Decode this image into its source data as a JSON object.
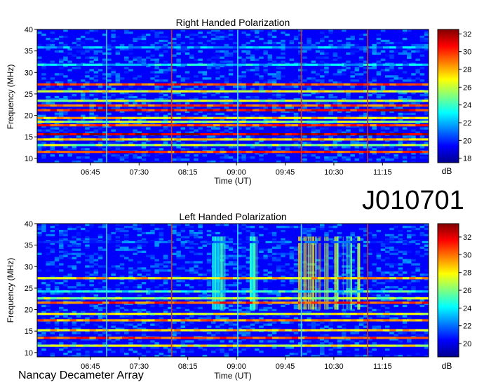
{
  "observation_id": "J010701",
  "footer_text": "Nancay Decameter Array",
  "chart_data": [
    {
      "type": "heatmap",
      "title": "Right Handed Polarization",
      "xlabel": "Time (UT)",
      "ylabel": "Frequency (MHz)",
      "x_tick_labels": [
        "06:45",
        "07:30",
        "08:15",
        "09:00",
        "09:45",
        "10:30",
        "11:15"
      ],
      "x_tick_hours": [
        6.75,
        7.5,
        8.25,
        9.0,
        9.75,
        10.5,
        11.25
      ],
      "xlim_hours": [
        5.93,
        11.96
      ],
      "yticks": [
        10,
        15,
        20,
        25,
        30,
        35,
        40
      ],
      "ylim": [
        9,
        40
      ],
      "colorbar": {
        "label": "dB",
        "ticks": [
          18,
          20,
          22,
          24,
          26,
          28,
          30,
          32
        ],
        "range": [
          17.5,
          32.5
        ]
      },
      "bright_bands_mhz": [
        {
          "f": 11.5,
          "level": 30
        },
        {
          "f": 13.1,
          "level": 26
        },
        {
          "f": 14.4,
          "level": 28
        },
        {
          "f": 15.6,
          "level": 32
        },
        {
          "f": 17.7,
          "level": 30
        },
        {
          "f": 18.5,
          "level": 26
        },
        {
          "f": 19.4,
          "level": 28
        },
        {
          "f": 21.2,
          "level": 31
        },
        {
          "f": 22.3,
          "level": 30
        },
        {
          "f": 23.4,
          "level": 26
        },
        {
          "f": 25.6,
          "level": 27
        },
        {
          "f": 27.2,
          "level": 30
        },
        {
          "f": 31.8,
          "level": 23
        },
        {
          "f": 35.8,
          "level": 22
        }
      ],
      "vertical_lines_hours": [
        {
          "t": 7.0,
          "color": "#33d9ff"
        },
        {
          "t": 8.0,
          "color": "#c0392b"
        },
        {
          "t": 9.02,
          "color": "#33d9ff"
        },
        {
          "t": 10.0,
          "color": "#c0392b"
        },
        {
          "t": 11.02,
          "color": "#c0392b"
        }
      ]
    },
    {
      "type": "heatmap",
      "title": "Left Handed Polarization",
      "xlabel": "Time (UT)",
      "ylabel": "Frequency (MHz)",
      "x_tick_labels": [
        "06:45",
        "07:30",
        "08:15",
        "09:00",
        "09:45",
        "10:30",
        "11:15"
      ],
      "x_tick_hours": [
        6.75,
        7.5,
        8.25,
        9.0,
        9.75,
        10.5,
        11.25
      ],
      "xlim_hours": [
        5.93,
        11.96
      ],
      "yticks": [
        10,
        15,
        20,
        25,
        30,
        35,
        40
      ],
      "ylim": [
        9,
        40
      ],
      "colorbar": {
        "label": "dB",
        "ticks": [
          20,
          22,
          24,
          26,
          28,
          30,
          32
        ],
        "range": [
          18.5,
          33.5
        ]
      },
      "bright_bands_mhz": [
        {
          "f": 11.6,
          "level": 28
        },
        {
          "f": 13.4,
          "level": 31
        },
        {
          "f": 15.2,
          "level": 29
        },
        {
          "f": 17.5,
          "level": 30
        },
        {
          "f": 19.0,
          "level": 28
        },
        {
          "f": 21.6,
          "level": 31
        },
        {
          "f": 22.6,
          "level": 27
        },
        {
          "f": 24.2,
          "level": 25
        },
        {
          "f": 27.3,
          "level": 29
        },
        {
          "f": 35.7,
          "level": 22
        }
      ],
      "bursts_hours": [
        {
          "t0": 8.6,
          "t1": 8.8,
          "level": 24
        },
        {
          "t0": 9.2,
          "t1": 9.3,
          "level": 24
        },
        {
          "t0": 9.9,
          "t1": 10.4,
          "level": 27
        },
        {
          "t0": 10.5,
          "t1": 10.9,
          "level": 26
        }
      ],
      "vertical_lines_hours": [
        {
          "t": 7.0,
          "color": "#33d9ff"
        },
        {
          "t": 8.0,
          "color": "#c0392b"
        },
        {
          "t": 9.02,
          "color": "#33d9ff"
        },
        {
          "t": 10.0,
          "color": "#33d9ff"
        },
        {
          "t": 11.02,
          "color": "#c0392b"
        }
      ]
    }
  ]
}
